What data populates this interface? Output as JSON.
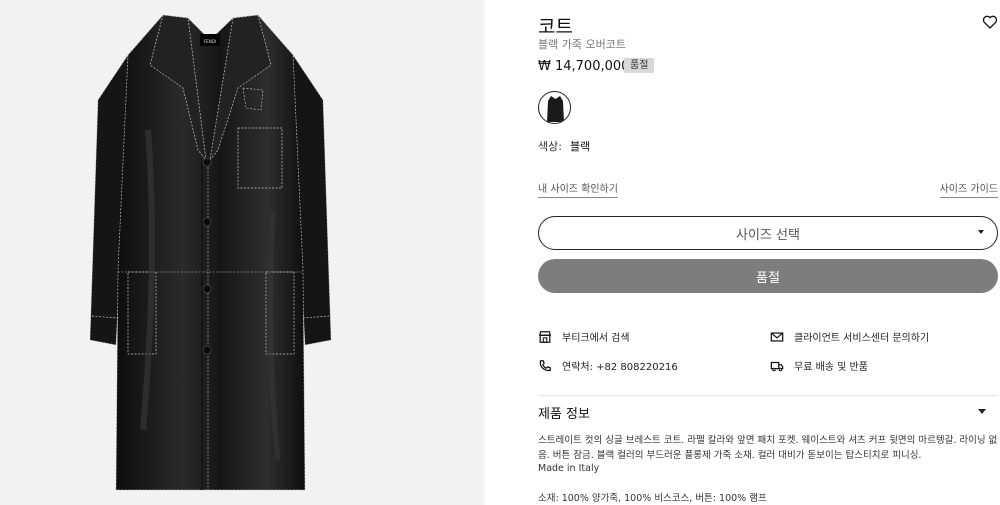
{
  "product": {
    "title": "코트",
    "subtitle": "블랙 가죽 오버코트",
    "price": "₩ 14,700,000",
    "sold_badge": "품절",
    "color_label": "색상:",
    "color_value": "블랙",
    "coat_brand_label": "FENDI"
  },
  "size": {
    "my_size_link": "내 사이즈 확인하기",
    "size_guide_link": "사이즈 가이드",
    "select_placeholder": "사이즈 선택"
  },
  "cta": {
    "sold_out_label": "품절"
  },
  "services": [
    {
      "label": "부티크에서 검색",
      "icon": "store-icon"
    },
    {
      "label": "클라이언트 서비스센터 문의하기",
      "icon": "mail-icon"
    },
    {
      "label": "연락처: +82 808220216",
      "icon": "phone-icon"
    },
    {
      "label": "무료 배송 및 반품",
      "icon": "delivery-icon"
    }
  ],
  "info": {
    "heading": "제품 정보",
    "description": "스트레이트 컷의 싱글 브레스트 코트. 라펠 칼라와 앞면 패치 포켓. 웨이스트와 셔츠 커프 뒷면의 마르텡갈. 라이닝 없음. 버튼 잠금. 블랙 컬러의 부드러운 플롱제 가죽 소재. 컬러 대비가 돋보이는 탑스티치로 피니싱.",
    "made_in": "Made in Italy",
    "material": "소재: 100% 양가죽, 100% 비스코스, 버튼: 100% 램프"
  },
  "colors": {
    "sold_button_bg": "#7d7d7d",
    "left_bg": "#f2f2f2",
    "coat": "#1a1a1a"
  }
}
